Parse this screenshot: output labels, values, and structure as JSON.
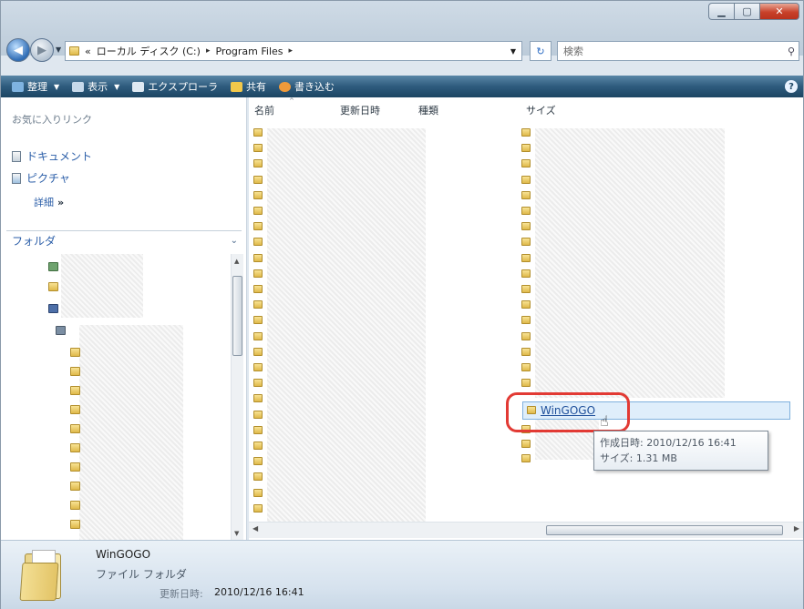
{
  "window": {
    "caption_buttons": [
      "minimize",
      "maximize",
      "close"
    ]
  },
  "address": {
    "chevrons": "«",
    "crumbs": [
      "ローカル ディスク (C:)",
      "Program Files"
    ],
    "separator": "▸",
    "search_placeholder": "検索"
  },
  "commandbar": {
    "items": [
      {
        "label": "整理",
        "icon": "organize-icon",
        "dropdown": true
      },
      {
        "label": "表示",
        "icon": "views-icon",
        "dropdown": true
      },
      {
        "label": "エクスプローラ",
        "icon": "explore-icon",
        "dropdown": false
      },
      {
        "label": "共有",
        "icon": "share-icon",
        "dropdown": false
      },
      {
        "label": "書き込む",
        "icon": "burn-icon",
        "dropdown": false
      }
    ],
    "help": "?"
  },
  "navpane": {
    "favorites_title": "お気に入りリンク",
    "favorites": [
      "ドキュメント",
      "ピクチャ"
    ],
    "more_label": "詳細",
    "more_arrows": "»",
    "folders_label": "フォルダ"
  },
  "filelist": {
    "columns": [
      "名前",
      "更新日時",
      "種類",
      "サイズ"
    ],
    "selected_item": "WinGOGO",
    "tooltip": {
      "created": "作成日時: 2010/12/16 16:41",
      "size": "サイズ: 1.31 MB"
    }
  },
  "details": {
    "name": "WinGOGO",
    "type": "ファイル フォルダ",
    "modified_label": "更新日時:",
    "modified_value": "2010/12/16 16:41"
  },
  "colors": {
    "command_bar": "#2e5b7d",
    "link_blue": "#2b5ea8",
    "highlight_red": "#e23a34",
    "selection": "#dfeefb"
  }
}
